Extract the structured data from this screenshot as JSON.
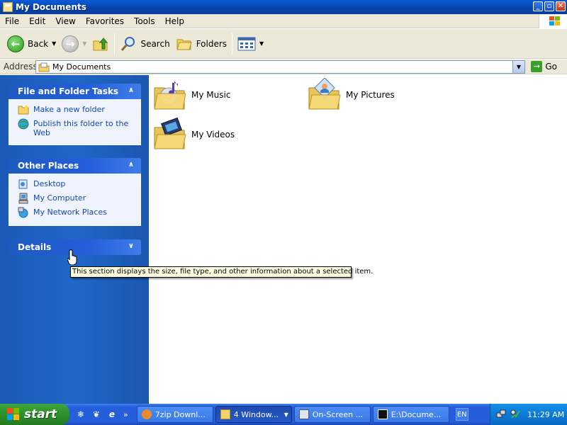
{
  "window": {
    "title": "My Documents",
    "buttons": {
      "minimize": "_",
      "maximize": "▫",
      "close": "✕"
    }
  },
  "menubar": {
    "items": [
      "File",
      "Edit",
      "View",
      "Favorites",
      "Tools",
      "Help"
    ]
  },
  "toolbar": {
    "back_label": "Back",
    "search_label": "Search",
    "folders_label": "Folders"
  },
  "addressbar": {
    "label": "Address",
    "value": "My Documents",
    "go_label": "Go"
  },
  "taskpane": {
    "file_tasks": {
      "title": "File and Folder Tasks",
      "items": [
        "Make a new folder",
        "Publish this folder to the Web"
      ]
    },
    "other_places": {
      "title": "Other Places",
      "items": [
        "Desktop",
        "My Computer",
        "My Network Places"
      ]
    },
    "details": {
      "title": "Details"
    }
  },
  "content": {
    "folders": [
      "My Music",
      "My Pictures",
      "My Videos"
    ]
  },
  "tooltip": {
    "text": "This section displays the size, file type, and other information about a selected item."
  },
  "taskbar": {
    "start_label": "start",
    "buttons": [
      "7zip Downl...",
      "4 Window...",
      "On-Screen ...",
      "E:\\Docume..."
    ],
    "language": "EN",
    "clock": "11:29 AM"
  },
  "colors": {
    "taskpane_blue": "#1b5dbd",
    "link_blue": "#1547b5",
    "start_green": "#2d8f2a",
    "taskbar_blue": "#245edb",
    "tray_blue": "#0f7ad6"
  }
}
